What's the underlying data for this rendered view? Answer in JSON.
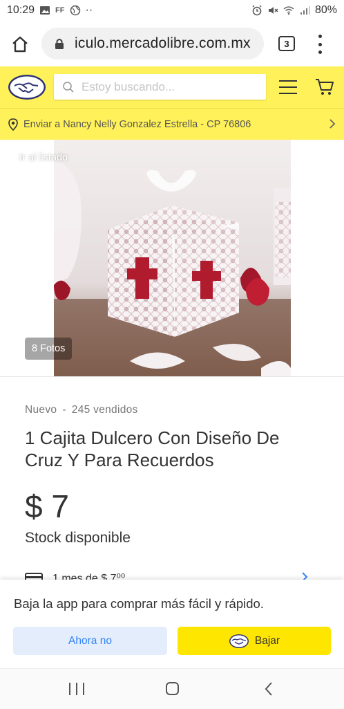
{
  "status_bar": {
    "time": "10:29",
    "left_icons": [
      "gallery-icon",
      "ff-icon",
      "globe-icon"
    ],
    "ff_label": "FF",
    "dots": "··",
    "right_icons": [
      "alarm-icon",
      "mute-icon",
      "wifi-icon",
      "signal-icon"
    ],
    "battery": "80%"
  },
  "browser": {
    "url": "iculo.mercadolibre.com.mx",
    "tab_count": "3"
  },
  "header": {
    "search_placeholder": "Estoy buscando...",
    "brand_color": "#fff159"
  },
  "shipping": {
    "text": "Enviar a Nancy Nelly Gonzalez Estrella - CP 76806"
  },
  "gallery": {
    "back_label": "Ir al listado",
    "photo_count": "8 Fotos"
  },
  "product": {
    "condition": "Nuevo",
    "separator": "-",
    "sold": "245 vendidos",
    "title": "1 Cajita Dulcero Con Diseño De Cruz Y Para Recuerdos",
    "price": "$ 7",
    "stock": "Stock disponible",
    "installments": "1 mes de $ 7⁰⁰"
  },
  "app_banner": {
    "text": "Baja la app para comprar más fácil y rápido.",
    "dismiss_label": "Ahora no",
    "download_label": "Bajar",
    "accent_color": "#3483fa",
    "cta_color": "#ffe600"
  }
}
